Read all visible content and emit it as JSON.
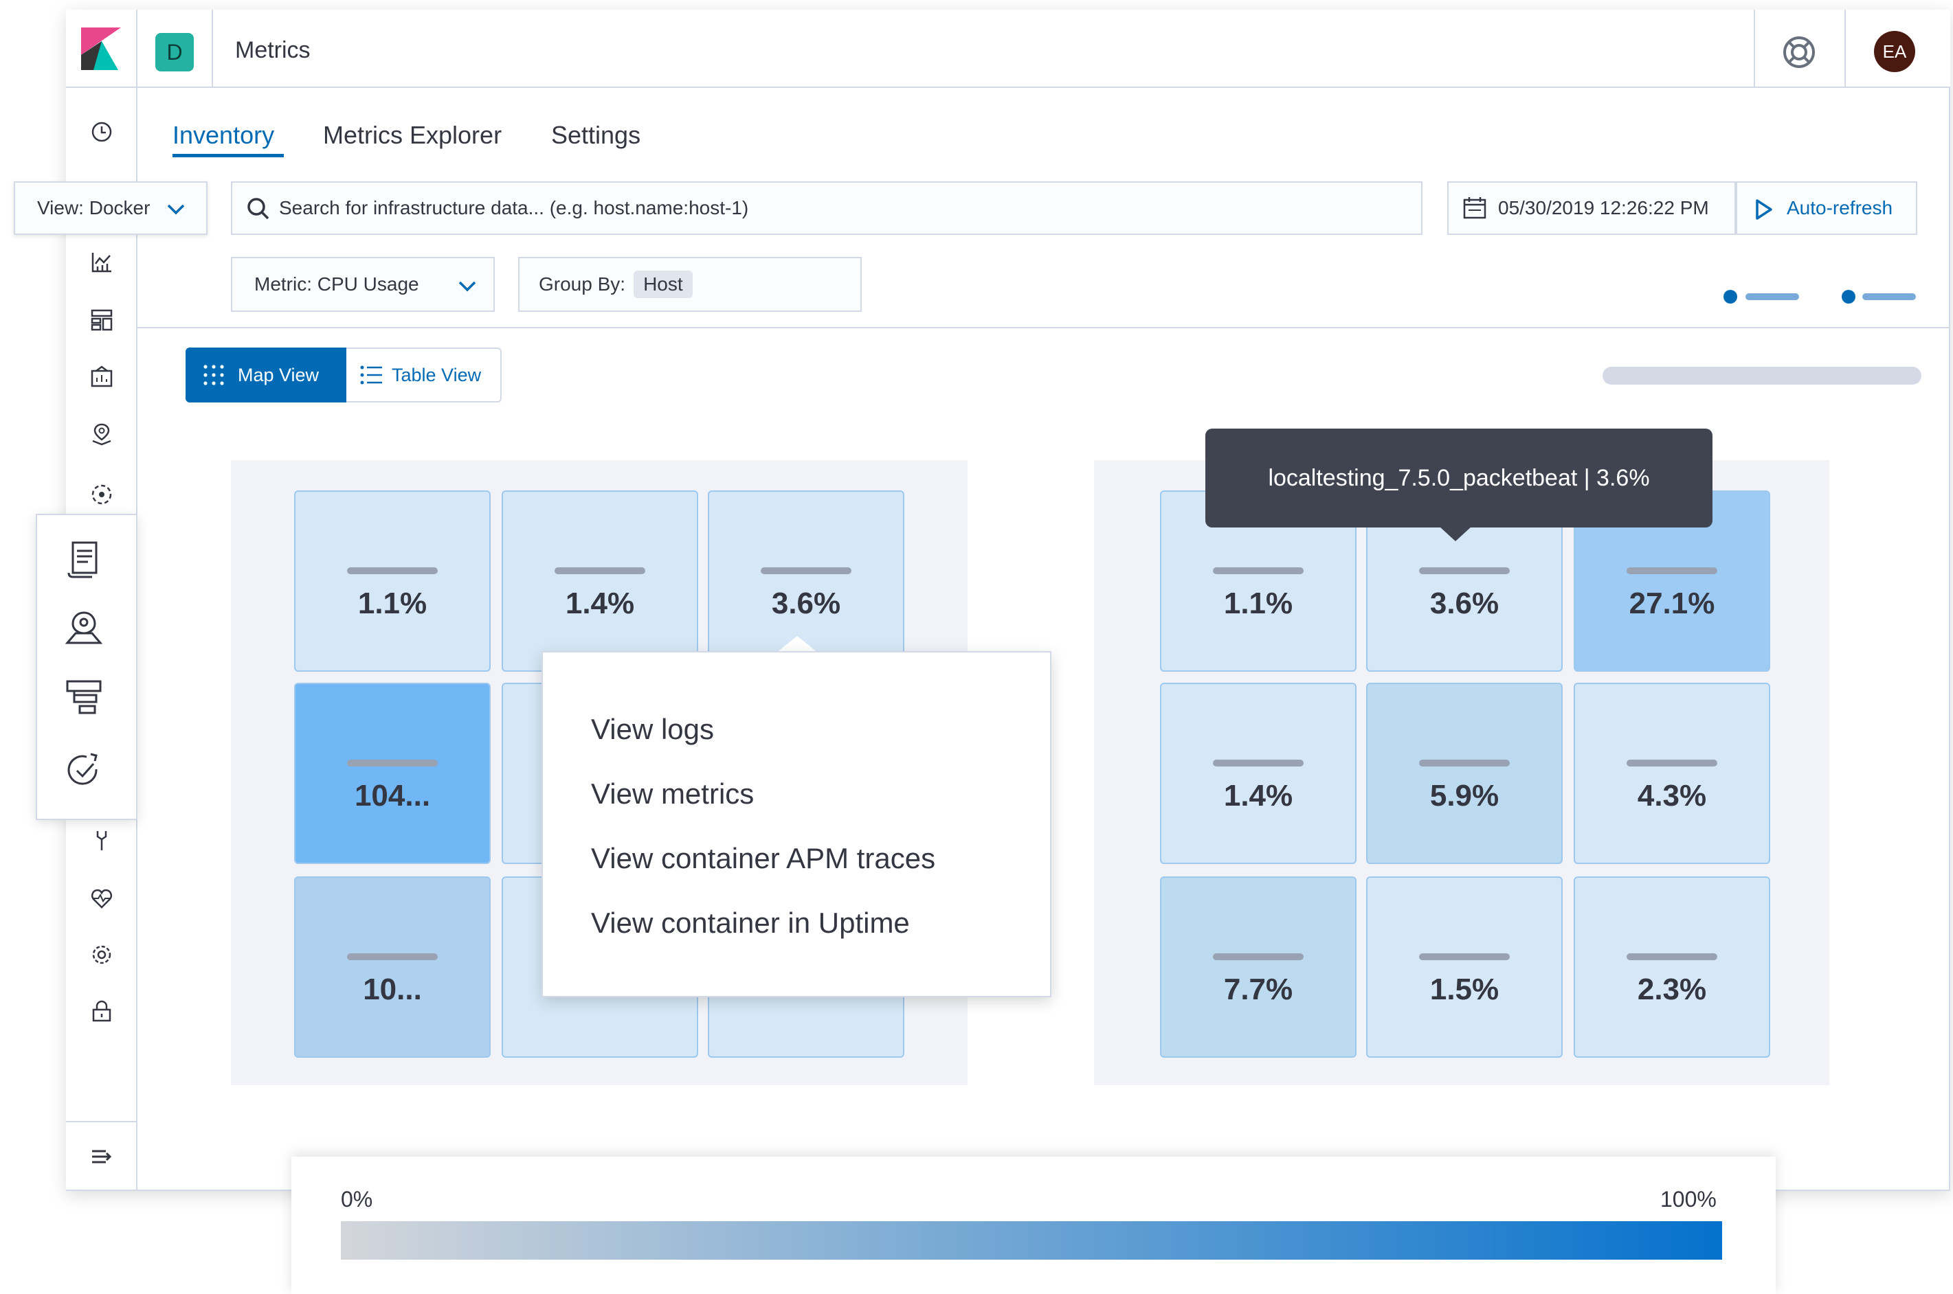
{
  "header": {
    "space_initial": "D",
    "app_title": "Metrics",
    "avatar_initials": "EA"
  },
  "tabs": [
    {
      "label": "Inventory",
      "active": true
    },
    {
      "label": "Metrics Explorer",
      "active": false
    },
    {
      "label": "Settings",
      "active": false
    }
  ],
  "toolbar": {
    "view_label": "View: Docker",
    "search_placeholder": "Search for infrastructure data... (e.g. host.name:host-1)",
    "date": "05/30/2019 12:26:22 PM",
    "auto_refresh": "Auto-refresh",
    "metric_label": "Metric: CPU Usage",
    "group_by_label": "Group By:",
    "group_by_value": "Host"
  },
  "view_toggle": {
    "map_view": "Map View",
    "table_view": "Table View",
    "active": "Map View"
  },
  "groups": [
    {
      "tiles": [
        {
          "value": "1.1%",
          "color": "#d6e8f7"
        },
        {
          "value": "1.4%",
          "color": "#d6e8f7"
        },
        {
          "value": "3.6%",
          "color": "#d6e8f7"
        },
        {
          "value": "104...",
          "color": "#72b7f5"
        },
        {
          "value": "",
          "color": "#d6e8f7"
        },
        {
          "value": "",
          "color": "#d6e8f7"
        },
        {
          "value": "10...",
          "color": "#add1ee"
        },
        {
          "value": "",
          "color": "#d6e8f7"
        },
        {
          "value": "",
          "color": "#d6e8f7"
        }
      ]
    },
    {
      "tiles": [
        {
          "value": "1.1%",
          "color": "#d6e8f7"
        },
        {
          "value": "3.6%",
          "color": "#d6e8f7"
        },
        {
          "value": "27.1%",
          "color": "#9dcbf3"
        },
        {
          "value": "1.4%",
          "color": "#d6e8f7"
        },
        {
          "value": "5.9%",
          "color": "#bcdaf0"
        },
        {
          "value": "4.3%",
          "color": "#d6e8f7"
        },
        {
          "value": "7.7%",
          "color": "#bcdaf0"
        },
        {
          "value": "1.5%",
          "color": "#d6e8f7"
        },
        {
          "value": "2.3%",
          "color": "#d6e8f7"
        }
      ]
    }
  ],
  "context_menu": {
    "items": [
      "View logs",
      "View metrics",
      "View container APM traces",
      "View container in Uptime"
    ]
  },
  "tooltip": {
    "text": "localtesting_7.5.0_packetbeat | 3.6%"
  },
  "legend": {
    "min": "0%",
    "max": "100%",
    "color_start": "#d3d6db",
    "color_end": "#0571cc"
  },
  "colors": {
    "accent": "#006bb4",
    "tile_border": "#9ec9ee"
  }
}
